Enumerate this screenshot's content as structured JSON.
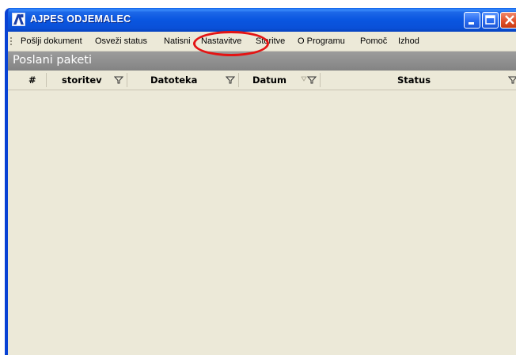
{
  "window": {
    "title": "AJPES ODJEMALEC",
    "icon": "ajpes-app-icon",
    "controls": [
      "minimize-icon",
      "maximize-icon",
      "close-icon"
    ]
  },
  "menu": {
    "items": [
      {
        "label": "Pošlji dokument"
      },
      {
        "label": "Osveži status"
      },
      {
        "label": "Natisni"
      },
      {
        "label": "Nastavitve"
      },
      {
        "label": "Storitve"
      },
      {
        "label": "O Programu"
      },
      {
        "label": "Pomoč"
      },
      {
        "label": "Izhod"
      }
    ],
    "highlighted_item": "Nastavitve",
    "highlight_color": "#e41414"
  },
  "panel": {
    "title": "Poslani paketi"
  },
  "grid": {
    "columns": [
      {
        "label": "#",
        "filter": false
      },
      {
        "label": "storitev",
        "filter": true
      },
      {
        "label": "Datoteka",
        "filter": true
      },
      {
        "label": "Datum",
        "filter": true,
        "sort_indicator": "sort-triangle-icon"
      },
      {
        "label": "Status",
        "filter": true
      }
    ],
    "rows": []
  },
  "colors": {
    "titlebar": "#0a56e0",
    "menubar": "#ece9d8",
    "panel_header": "#8c8c8c",
    "grid_body": "#ece9d8"
  }
}
